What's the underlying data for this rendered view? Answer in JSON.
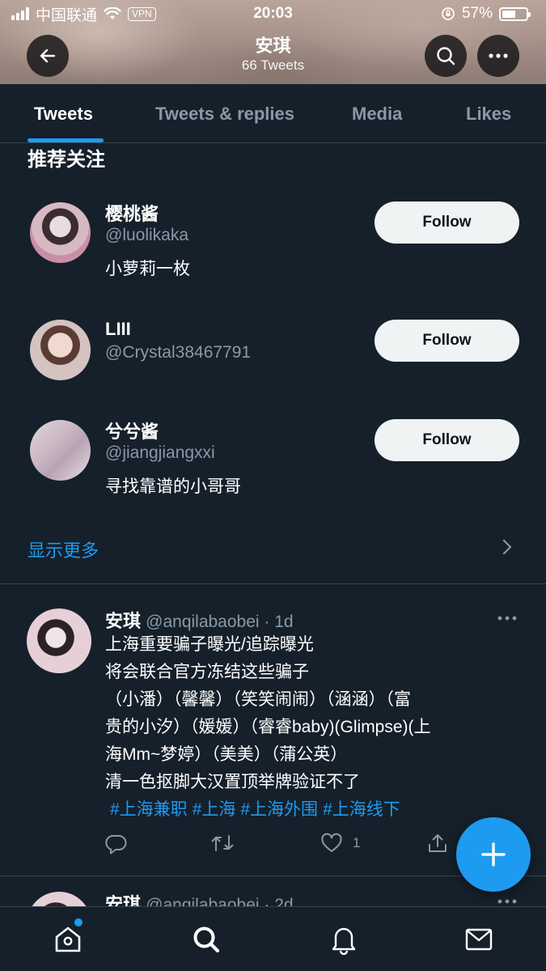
{
  "status_bar": {
    "carrier": "中国联通",
    "vpn": "VPN",
    "time": "20:03",
    "battery": "57%",
    "battery_level": 0.57
  },
  "header": {
    "name": "安琪",
    "tweet_count": "66 Tweets",
    "back_icon": "arrow-left-icon",
    "search_icon": "search-icon",
    "more_icon": "more-horizontal-icon"
  },
  "tabs": [
    {
      "label": "Tweets",
      "active": true
    },
    {
      "label": "Tweets & replies",
      "active": false
    },
    {
      "label": "Media",
      "active": false
    },
    {
      "label": "Likes",
      "active": false
    }
  ],
  "suggestions": {
    "title": "推荐关注",
    "items": [
      {
        "name": "樱桃酱",
        "handle": "@luolikaka",
        "bio": "小萝莉一枚",
        "button": "Follow"
      },
      {
        "name": "LIII",
        "handle": "@Crystal38467791",
        "bio": "",
        "button": "Follow"
      },
      {
        "name": "兮兮酱",
        "handle": "@jiangjiangxxi",
        "bio": "寻找靠谱的小哥哥",
        "button": "Follow"
      }
    ],
    "show_more": "显示更多"
  },
  "tweets": [
    {
      "name": "安琪",
      "meta": "@anqilabaobei · 1d",
      "lines": [
        "上海重要骗子曝光/追踪曝光",
        "将会联合官方冻结这些骗子",
        "（小潘）（馨馨）（笑笑闹闹）（涵涵）（富",
        "贵的小汐）（媛媛）（睿睿baby)(Glimpse)(上",
        "海Mm~梦婷）（美美）（蒲公英）",
        "清一色抠脚大汉置顶举牌验证不了"
      ],
      "hashtags": [
        "#上海兼职",
        "#上海",
        "#上海外围",
        "#上海线下"
      ],
      "likes": "1"
    },
    {
      "name": "安琪",
      "meta": "@anqilabaobei · 2d"
    }
  ],
  "colors": {
    "background": "#15202b",
    "accent": "#1d9bf0",
    "muted": "#8b98a5",
    "divider": "#38444d"
  },
  "bottom_nav": [
    "home-icon",
    "search-icon",
    "bell-icon",
    "mail-icon"
  ]
}
